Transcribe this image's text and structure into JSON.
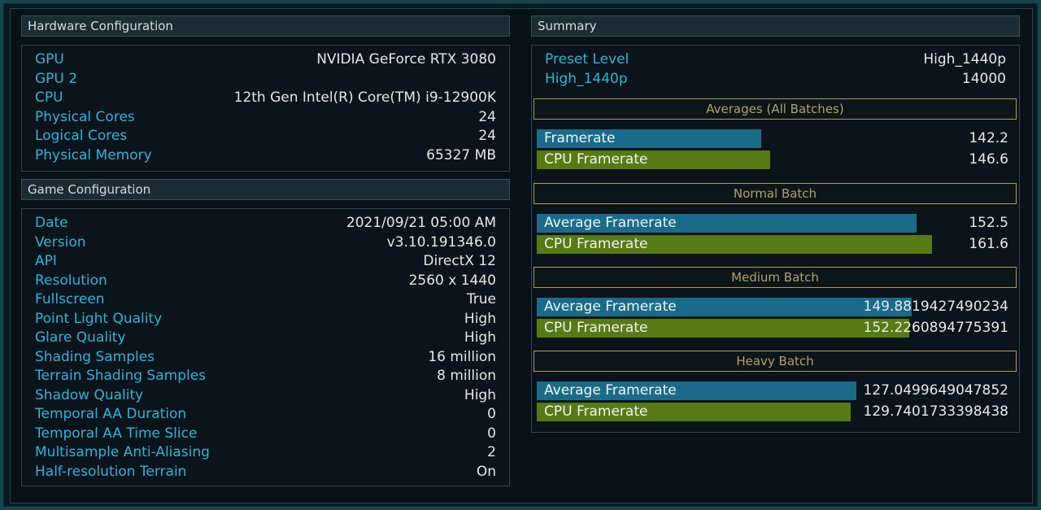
{
  "hardware": {
    "title": "Hardware Configuration",
    "rows": [
      {
        "key": "GPU",
        "value": "NVIDIA GeForce RTX 3080"
      },
      {
        "key": "GPU 2",
        "value": ""
      },
      {
        "key": "CPU",
        "value": "12th Gen Intel(R) Core(TM) i9-12900K"
      },
      {
        "key": "Physical Cores",
        "value": "24"
      },
      {
        "key": "Logical Cores",
        "value": "24"
      },
      {
        "key": "Physical Memory",
        "value": "65327 MB"
      }
    ]
  },
  "game": {
    "title": "Game Configuration",
    "rows": [
      {
        "key": "Date",
        "value": "2021/09/21 05:00 AM"
      },
      {
        "key": "Version",
        "value": "v3.10.191346.0"
      },
      {
        "key": "API",
        "value": "DirectX 12"
      },
      {
        "key": "Resolution",
        "value": "2560 x 1440"
      },
      {
        "key": "Fullscreen",
        "value": "True"
      },
      {
        "key": "Point Light Quality",
        "value": "High"
      },
      {
        "key": "Glare Quality",
        "value": "High"
      },
      {
        "key": "Shading Samples",
        "value": "16 million"
      },
      {
        "key": "Terrain Shading Samples",
        "value": "8 million"
      },
      {
        "key": "Shadow Quality",
        "value": "High"
      },
      {
        "key": "Temporal AA Duration",
        "value": "0"
      },
      {
        "key": "Temporal AA Time Slice",
        "value": "0"
      },
      {
        "key": "Multisample Anti-Aliasing",
        "value": "2"
      },
      {
        "key": "Half-resolution Terrain",
        "value": "On"
      }
    ]
  },
  "summary": {
    "title": "Summary",
    "rows": [
      {
        "key": "Preset Level",
        "value": "High_1440p"
      },
      {
        "key": "High_1440p",
        "value": "14000"
      }
    ],
    "sections": [
      {
        "title": "Averages (All Batches)",
        "bars": [
          {
            "label": "Framerate",
            "value": "142.2",
            "color": "#1a6b8a",
            "fraction": 0.475
          },
          {
            "label": "CPU Framerate",
            "value": "146.6",
            "color": "#577b14",
            "fraction": 0.494
          }
        ]
      },
      {
        "title": "Normal Batch",
        "bars": [
          {
            "label": "Average Framerate",
            "value": "152.5",
            "color": "#1a6b8a",
            "fraction": 0.806
          },
          {
            "label": "CPU Framerate",
            "value": "161.6",
            "color": "#577b14",
            "fraction": 0.838
          }
        ]
      },
      {
        "title": "Medium Batch",
        "bars": [
          {
            "label": "Average Framerate",
            "value": "149.8819427490234",
            "color": "#1a6b8a",
            "fraction": 0.795
          },
          {
            "label": "CPU Framerate",
            "value": "152.2260894775391",
            "color": "#577b14",
            "fraction": 0.79
          }
        ]
      },
      {
        "title": "Heavy Batch",
        "bars": [
          {
            "label": "Average Framerate",
            "value": "127.0499649047852",
            "color": "#1a6b8a",
            "fraction": 0.677
          },
          {
            "label": "CPU Framerate",
            "value": "129.7401733398438",
            "color": "#577b14",
            "fraction": 0.665
          }
        ]
      }
    ]
  }
}
